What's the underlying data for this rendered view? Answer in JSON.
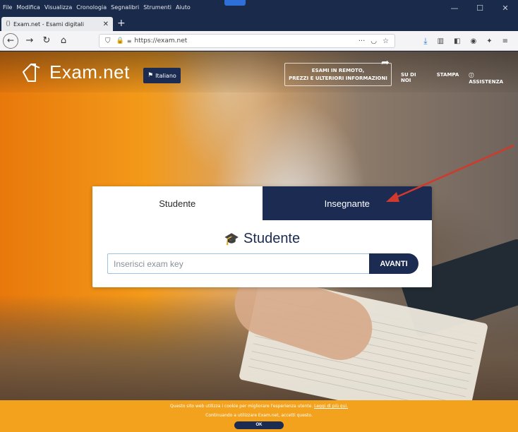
{
  "menubar": {
    "items": [
      "File",
      "Modifica",
      "Visualizza",
      "Cronologia",
      "Segnalibri",
      "Strumenti",
      "Aiuto"
    ]
  },
  "window_controls": {
    "minimize": "—",
    "maximize": "☐",
    "close": "✕"
  },
  "tab": {
    "title": "Exam.net - Esami digitali",
    "close": "✕",
    "new": "+"
  },
  "navbar": {
    "url": "https://exam.net",
    "actions_icon": "···"
  },
  "header": {
    "logo_text": "Exam.net",
    "language_button": "Italiano",
    "remote_line1": "ESAMI IN REMOTO,",
    "remote_line2": "PREZZI E ULTERIORI INFORMAZIONI",
    "nav": {
      "about": "SU DI NOI",
      "print": "STAMPA",
      "support": "ⓘ ASSISTENZA"
    }
  },
  "card": {
    "tab_student": "Studente",
    "tab_teacher": "Insegnante",
    "heading": "Studente",
    "input_placeholder": "Inserisci exam key",
    "submit_label": "AVANTI"
  },
  "cookie": {
    "text": "Questo sito web utilizza i cookie per migliorare l'esperienza utente.",
    "link": "Leggi di più qui.",
    "line2": "Continuando a utilizzare Exam.net, accetti questo.",
    "ok": "OK"
  },
  "colors": {
    "navy": "#1b2b52",
    "orange": "#f3a21d",
    "annotation_arrow": "#d0392b"
  }
}
